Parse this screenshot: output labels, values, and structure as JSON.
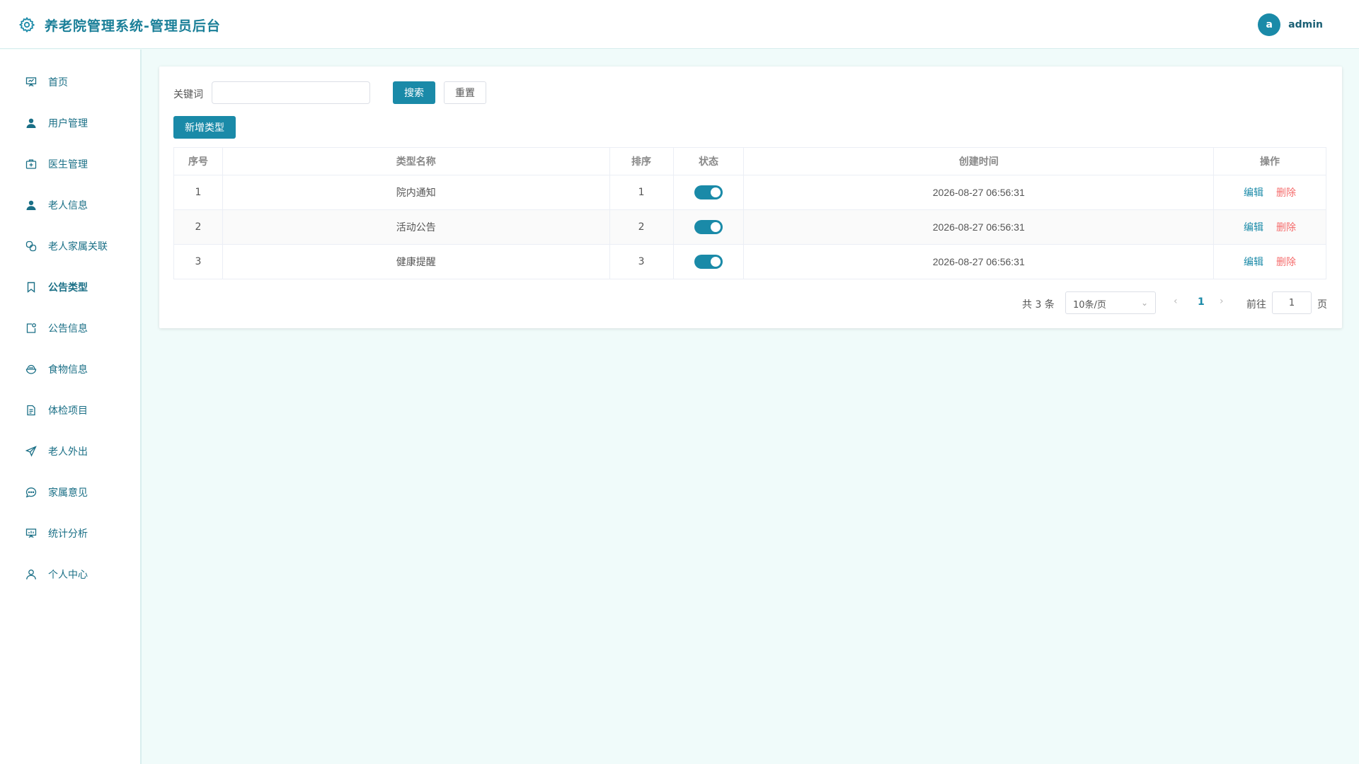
{
  "header": {
    "title": "养老院管理系统-管理员后台",
    "avatar_letter": "a",
    "username": "admin",
    "logo_icon": "gear-icon"
  },
  "sidebar": {
    "items": [
      {
        "label": "首页",
        "icon": "presentation-icon"
      },
      {
        "label": "用户管理",
        "icon": "user-icon"
      },
      {
        "label": "医生管理",
        "icon": "medical-kit-icon"
      },
      {
        "label": "老人信息",
        "icon": "person-icon"
      },
      {
        "label": "老人家属关联",
        "icon": "link-icon"
      },
      {
        "label": "公告类型",
        "icon": "bookmark-icon"
      },
      {
        "label": "公告信息",
        "icon": "notice-icon"
      },
      {
        "label": "食物信息",
        "icon": "bowl-icon"
      },
      {
        "label": "体检项目",
        "icon": "document-icon"
      },
      {
        "label": "老人外出",
        "icon": "send-icon"
      },
      {
        "label": "家属意见",
        "icon": "chat-icon"
      },
      {
        "label": "统计分析",
        "icon": "chart-board-icon"
      },
      {
        "label": "个人中心",
        "icon": "profile-icon"
      }
    ],
    "active_index": 5
  },
  "search": {
    "label": "关键词",
    "value": "",
    "placeholder": "",
    "search_button": "搜索",
    "reset_button": "重置"
  },
  "add_button": "新增类型",
  "table": {
    "columns": [
      "序号",
      "类型名称",
      "排序",
      "状态",
      "创建时间",
      "操作"
    ],
    "rows": [
      {
        "index": "1",
        "name": "院内通知",
        "sort": "1",
        "status_on": true,
        "created": "2026-08-27 06:56:31",
        "edit": "编辑",
        "delete": "删除"
      },
      {
        "index": "2",
        "name": "活动公告",
        "sort": "2",
        "status_on": true,
        "created": "2026-08-27 06:56:31",
        "edit": "编辑",
        "delete": "删除"
      },
      {
        "index": "3",
        "name": "健康提醒",
        "sort": "3",
        "status_on": true,
        "created": "2026-08-27 06:56:31",
        "edit": "编辑",
        "delete": "删除"
      }
    ]
  },
  "pagination": {
    "total_text": "共 3 条",
    "page_size": "10条/页",
    "current_page": "1",
    "goto_label": "前往",
    "goto_value": "1",
    "page_unit": "页"
  },
  "colors": {
    "accent": "#1a8aa8",
    "danger": "#f56c6c",
    "background": "#f0fbfa"
  }
}
